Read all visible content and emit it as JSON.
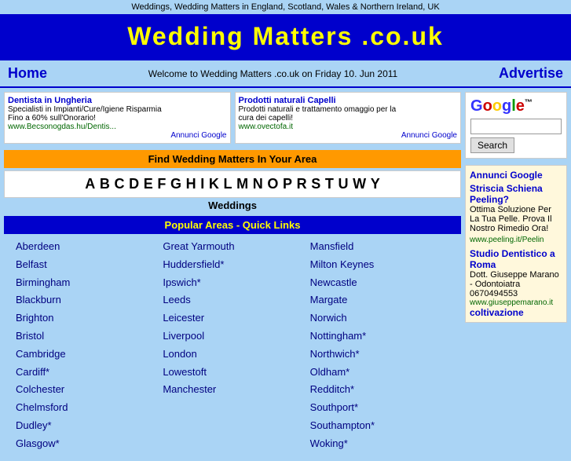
{
  "topbar": {
    "text": "Weddings, Wedding Matters in England, Scotland, Wales & Northern Ireland, UK"
  },
  "header": {
    "title": "Wedding Matters .co.uk"
  },
  "nav": {
    "home_label": "Home",
    "center_text": "Welcome to Wedding Matters .co.uk on Friday 10. Jun 2011",
    "advertise_label": "Advertise"
  },
  "ads": {
    "left": {
      "title": "Dentista in Ungheria",
      "desc1": "Specialisti in Impianti/Cure/Igiene Risparmia",
      "desc2": "Fino a 60% sull'Onorario!",
      "url": "www.Becsonogdas.hu/Dentis...",
      "badge": "Annunci Google"
    },
    "right": {
      "title": "Prodotti naturali Capelli",
      "desc1": "Prodotti naturali e trattamento omaggio per la",
      "desc2": "cura dei capelli!",
      "url": "www.ovectofa.it",
      "badge": "Annunci Google"
    }
  },
  "find_banner": "Find Wedding Matters In Your Area",
  "alphabet": [
    "A",
    "B",
    "C",
    "D",
    "E",
    "F",
    "G",
    "H",
    "I",
    "K",
    "L",
    "M",
    "N",
    "O",
    "P",
    "R",
    "S",
    "T",
    "U",
    "W",
    "Y"
  ],
  "weddings_label": "Weddings",
  "popular_areas": {
    "header": "Popular Areas - Quick Links",
    "col1": [
      "Aberdeen",
      "Belfast",
      "Birmingham",
      "Blackburn",
      "Brighton",
      "Bristol",
      "Cambridge",
      "Cardiff*",
      "Colchester",
      "Chelmsford",
      "Dudley*",
      "Glasgow*"
    ],
    "col2": [
      "Great Yarmouth",
      "Huddersfield*",
      "Ipswich*",
      "Leeds",
      "Leicester",
      "Liverpool",
      "London",
      "Lowestoft",
      "Manchester"
    ],
    "col3": [
      "Mansfield",
      "Milton Keynes",
      "Newcastle",
      "Margate",
      "Norwich",
      "Nottingham*",
      "Northwich*",
      "Oldham*",
      "Redditch*",
      "Southport*",
      "Southampton*",
      "Woking*"
    ]
  },
  "google": {
    "logo": "Google",
    "search_btn": "Search",
    "input_placeholder": ""
  },
  "sidebar_ads": {
    "title": "Annunci Google",
    "ad1_link": "Striscia Schiena Peeling?",
    "ad1_desc": "Ottima Soluzione Per La Tua Pelle. Prova Il Nostro Rimedio Ora!",
    "ad1_url": "www.peeling.it/Peelin",
    "ad2_link": "Studio Dentistico a Roma",
    "ad2_desc": "Dott. Giuseppe Marano - Odontoiatra 0670494553",
    "ad2_url": "www.giuseppemarano.it",
    "ad3_link": "coltivazione"
  }
}
